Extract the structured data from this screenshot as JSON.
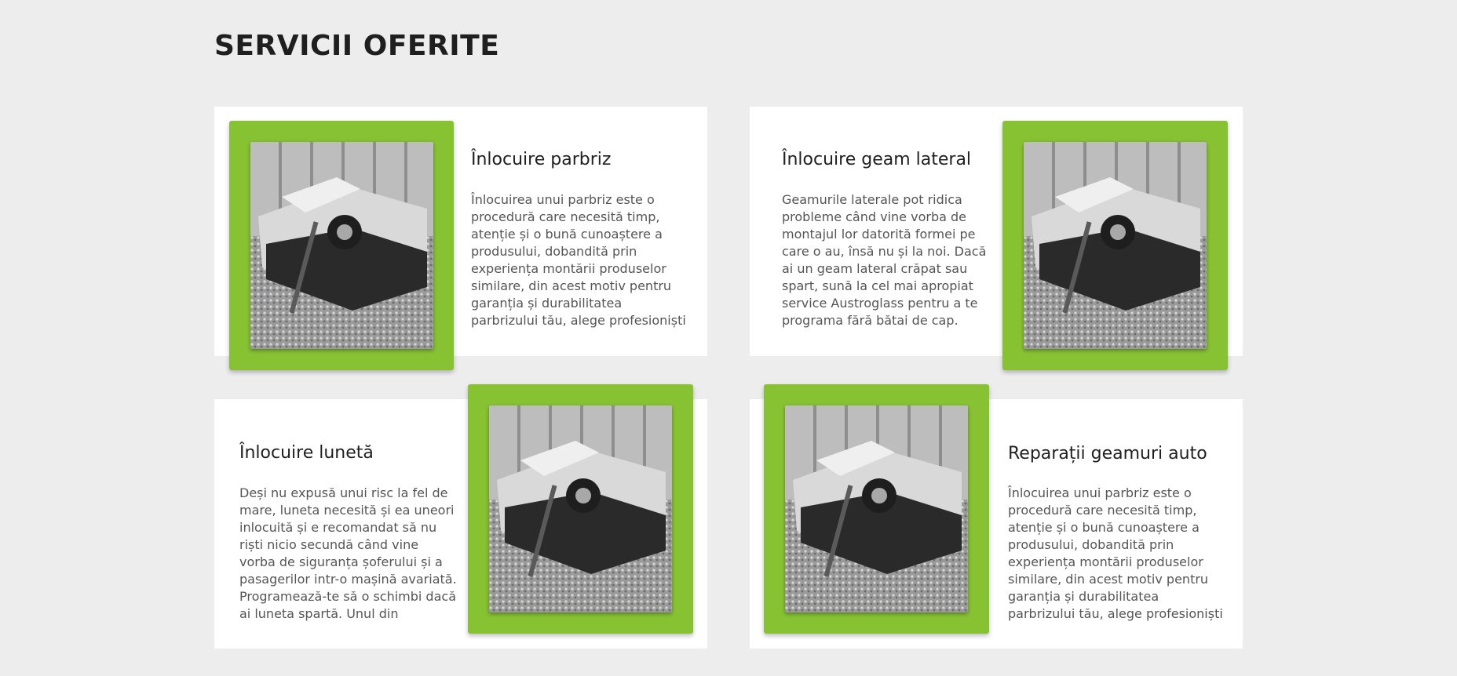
{
  "section": {
    "title": "SERVICII OFERITE"
  },
  "accent_color": "#86c232",
  "cards": [
    {
      "title": "Înlocuire parbriz",
      "text": "Înlocuirea unui parbriz este o procedură care necesită timp, atenție și o bună cunoaștere a produsului, dobandită prin experiența montării produselor similare, din acest motiv pentru garanția și durabilitatea parbrizului tău, alege profesioniști și service-uri autorizate."
    },
    {
      "title": "Înlocuire geam lateral",
      "text": "Geamurile laterale pot ridica probleme când vine vorba de montajul lor datorită formei pe care o au, însă nu și la noi. Dacă ai un geam lateral crăpat sau spart, sună la cel mai apropiat service Austroglass pentru a te programa fără bătai de cap."
    },
    {
      "title": "Înlocuire lunetă",
      "text": "Deși nu expusă unui risc la fel de mare, luneta necesită și ea uneori inlocuită și e recomandat să nu riști nicio secundă când vine vorba de siguranța șoferului și a pasagerilor intr-o mașină avariată. Programează-te să o schimbi dacă ai luneta spartă. Unul din consultanții noștri te poate ajuta să-ți alegi modelul"
    },
    {
      "title": "Reparații geamuri auto",
      "text": "Înlocuirea unui parbriz este o procedură care necesită timp, atenție și o bună cunoaștere a produsului, dobandită prin experiența montării produselor similare, din acest motiv pentru garanția și durabilitatea parbrizului tău, alege profesioniști și service-uri autorizate."
    }
  ]
}
